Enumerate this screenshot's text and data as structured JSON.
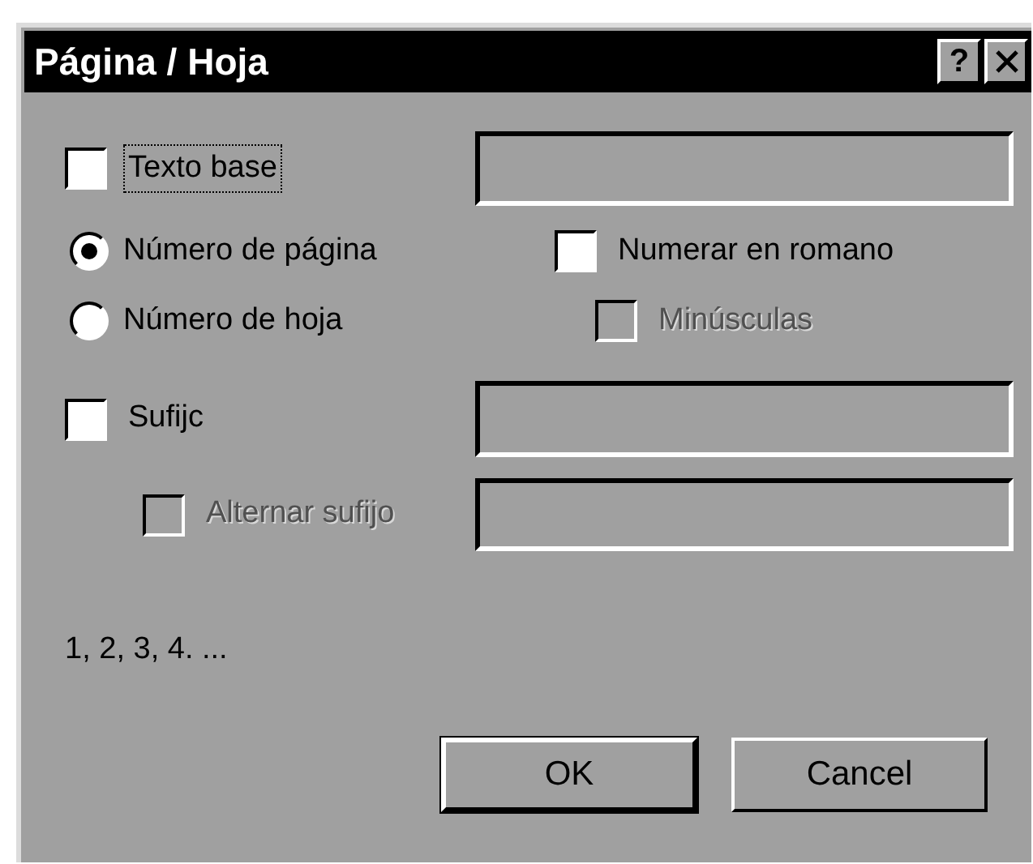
{
  "window": {
    "title": "Página / Hoja",
    "help_button": {
      "label": "?"
    }
  },
  "base_text": {
    "label": "Texto base",
    "checked": false,
    "focused": true
  },
  "numbering": [
    {
      "label": "Número de página",
      "selected": true
    },
    {
      "label": "Número de hoja",
      "selected": false
    }
  ],
  "roman": {
    "label": "Numerar en romano",
    "checked": false,
    "disabled": false
  },
  "lowercase": {
    "label": "Minúsculas",
    "checked": false,
    "disabled": true
  },
  "suffix": {
    "label": "Sufijc",
    "checked": false,
    "disabled": false
  },
  "alternate_suffix": {
    "label": "Alternar sufijo",
    "checked": false,
    "disabled": true
  },
  "preview": "1, 2, 3, 4. ...",
  "buttons": [
    {
      "label": "OK",
      "default": true
    },
    {
      "label": "Cancel",
      "default": false
    }
  ]
}
